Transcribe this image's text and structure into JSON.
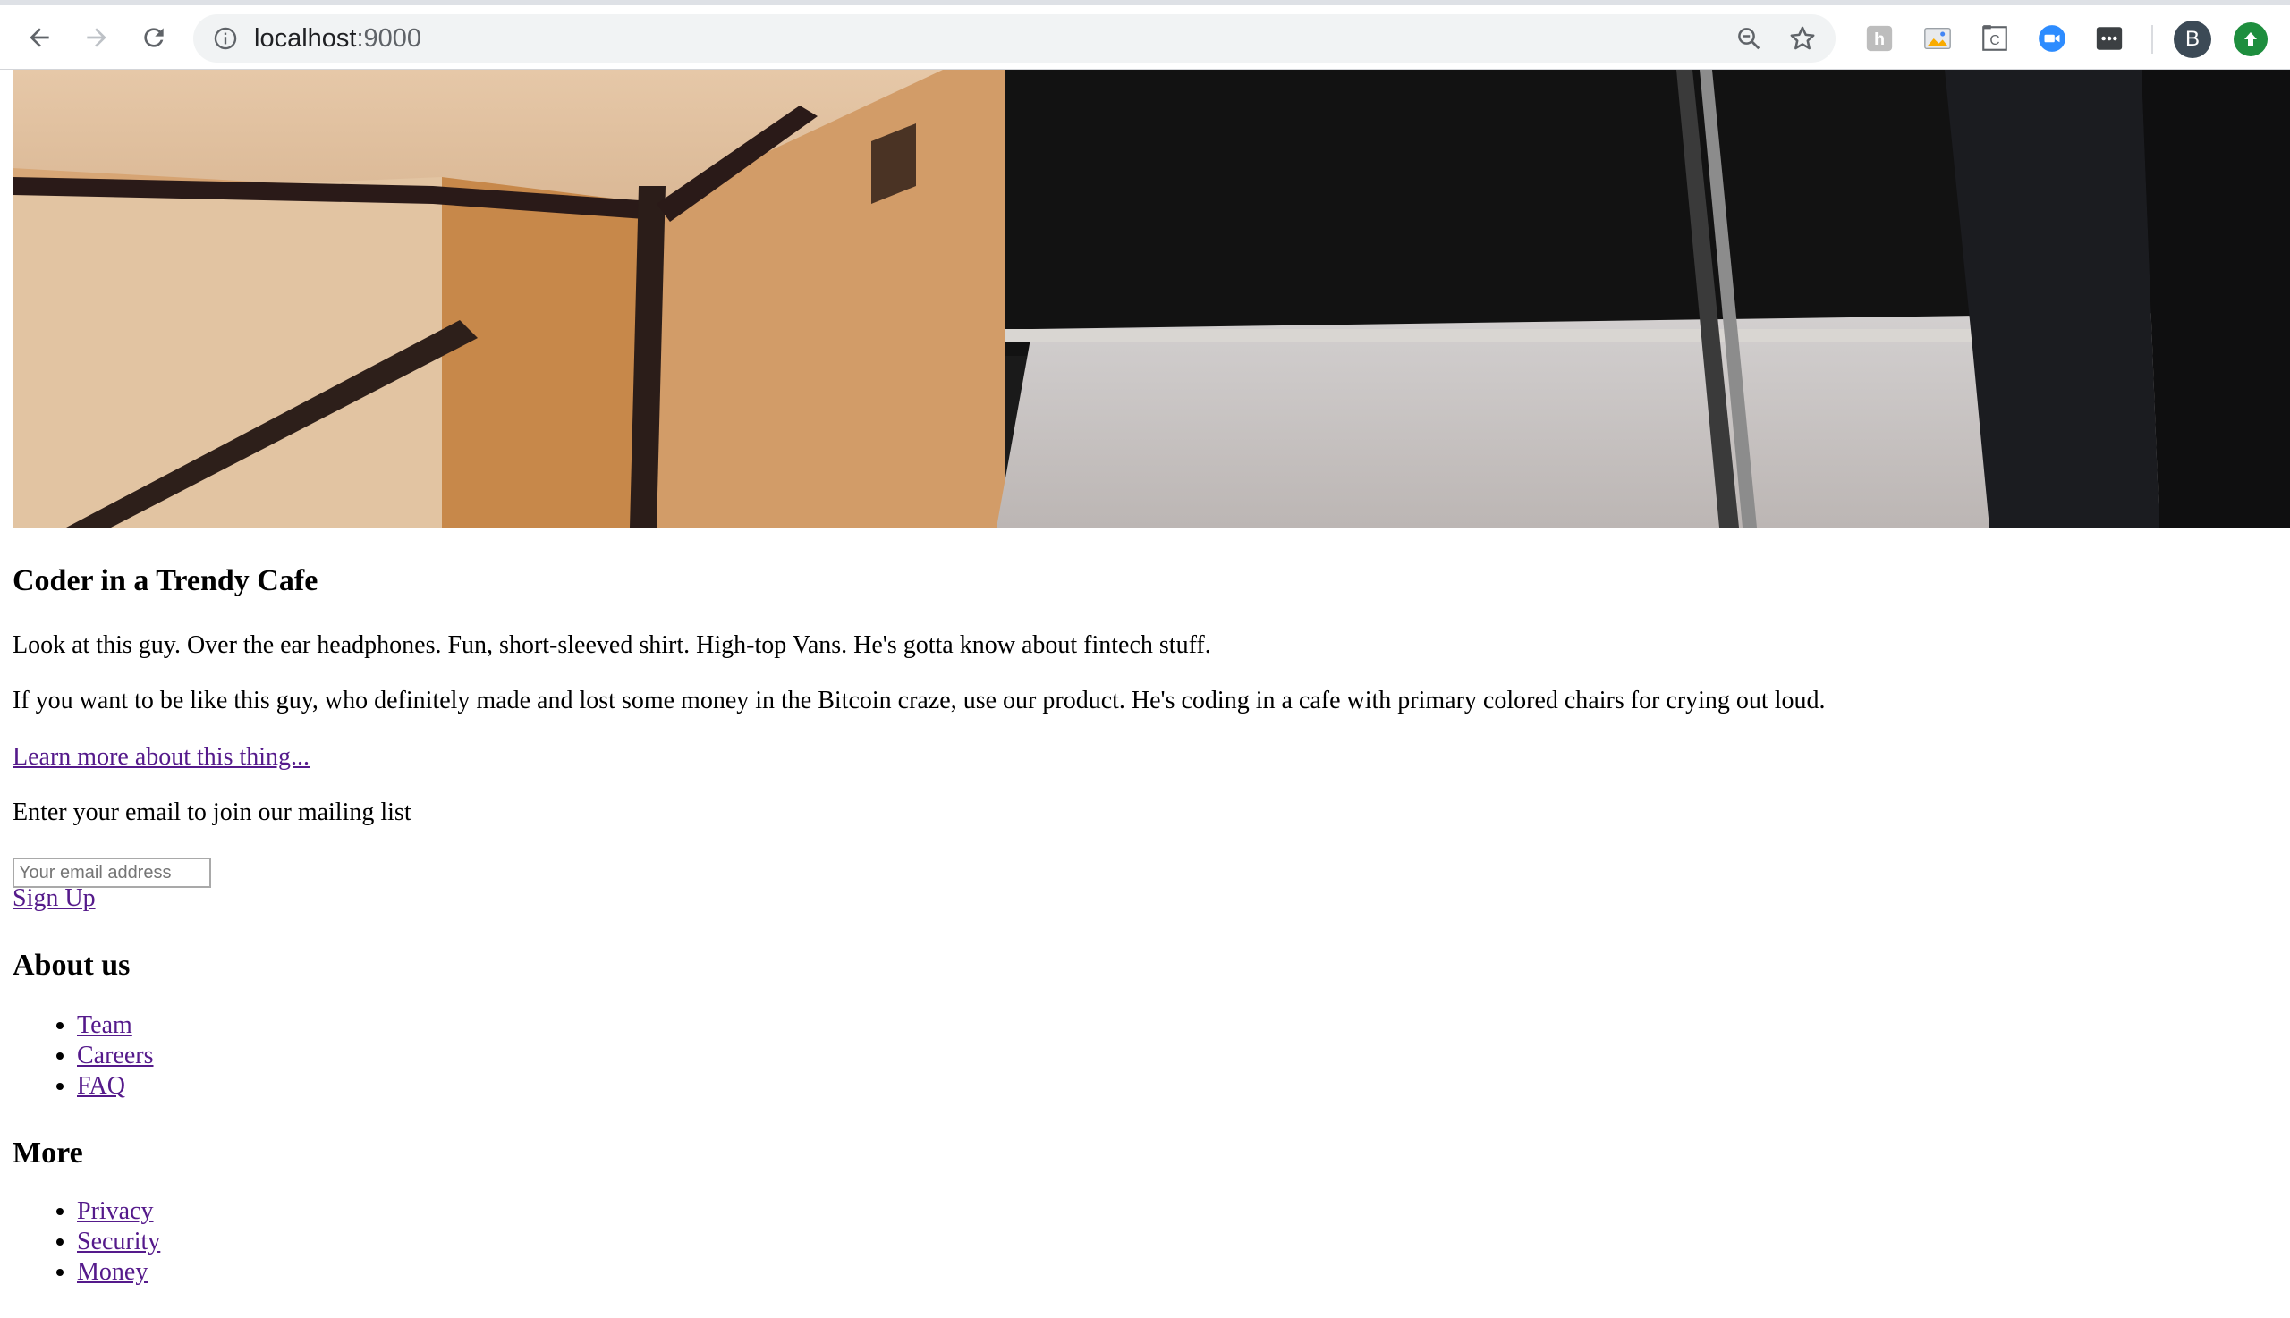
{
  "browser": {
    "url_host": "localhost",
    "url_port": ":9000",
    "profile_initial": "B",
    "extensions": [
      "hypothesis-icon",
      "image-extension-icon",
      "c-extension-icon",
      "zoom-icon",
      "more-options-icon"
    ]
  },
  "hero": {
    "image_alt": "Coder in a Trendy Cafe"
  },
  "article": {
    "title": "Coder in a Trendy Cafe",
    "paragraph1": "Look at this guy. Over the ear headphones. Fun, short-sleeved shirt. High-top Vans. He's gotta know about fintech stuff.",
    "paragraph2": "If you want to be like this guy, who definitely made and lost some money in the Bitcoin craze, use our product. He's coding in a cafe with primary colored chairs for crying out loud.",
    "learn_more": "Learn more about this thing..."
  },
  "signup": {
    "prompt": "Enter your email to join our mailing list",
    "email_placeholder": "Your email address",
    "email_value": "",
    "button_label": "Sign Up"
  },
  "about": {
    "heading": "About us",
    "links": [
      "Team",
      "Careers",
      "FAQ"
    ]
  },
  "more": {
    "heading": "More",
    "links": [
      "Privacy",
      "Security",
      "Money"
    ]
  }
}
